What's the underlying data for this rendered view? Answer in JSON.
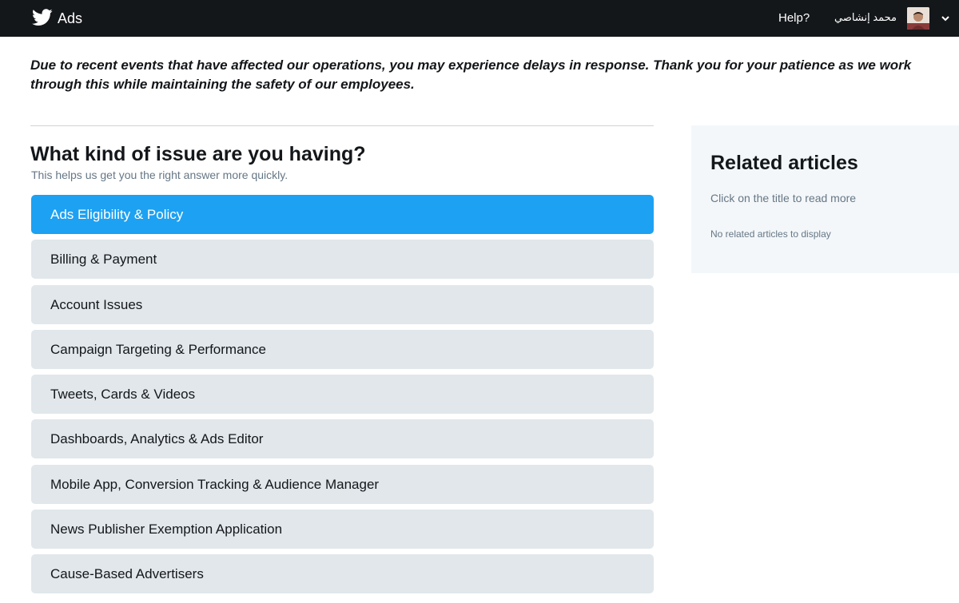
{
  "header": {
    "brand": "Ads",
    "help_label": "Help?",
    "user_name": "محمد إنشاصي",
    "logo_icon": "twitter-bird-icon",
    "menu_icon": "chevron-down-icon",
    "background_color": "#14171a"
  },
  "notice": {
    "text": "Due to recent events that have affected our operations, you may experience delays in response. Thank you for your patience as we work through this while maintaining the safety of our employees."
  },
  "issue_form": {
    "title": "What kind of issue are you having?",
    "subtitle": "This helps us get you the right answer more quickly.",
    "selected_index": 0,
    "options": [
      {
        "label": "Ads Eligibility & Policy"
      },
      {
        "label": "Billing & Payment"
      },
      {
        "label": "Account Issues"
      },
      {
        "label": "Campaign Targeting & Performance"
      },
      {
        "label": "Tweets, Cards & Videos"
      },
      {
        "label": "Dashboards, Analytics & Ads Editor"
      },
      {
        "label": "Mobile App, Conversion Tracking & Audience Manager"
      },
      {
        "label": "News Publisher Exemption Application"
      },
      {
        "label": "Cause-Based Advertisers"
      }
    ],
    "colors": {
      "selected": "#1da1f2",
      "unselected": "#e1e7eb"
    }
  },
  "related": {
    "title": "Related articles",
    "hint": "Click on the title to read more",
    "empty_text": "No related articles to display"
  }
}
